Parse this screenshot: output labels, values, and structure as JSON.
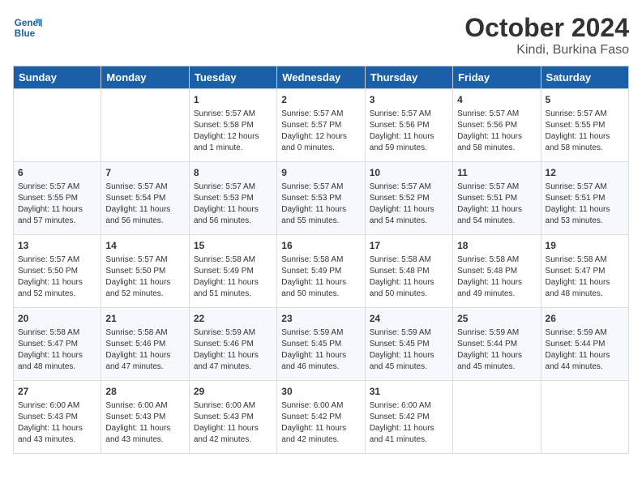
{
  "header": {
    "logo_line1": "General",
    "logo_line2": "Blue",
    "title": "October 2024",
    "subtitle": "Kindi, Burkina Faso"
  },
  "days_of_week": [
    "Sunday",
    "Monday",
    "Tuesday",
    "Wednesday",
    "Thursday",
    "Friday",
    "Saturday"
  ],
  "weeks": [
    [
      {
        "day": "",
        "detail": ""
      },
      {
        "day": "",
        "detail": ""
      },
      {
        "day": "1",
        "detail": "Sunrise: 5:57 AM\nSunset: 5:58 PM\nDaylight: 12 hours\nand 1 minute."
      },
      {
        "day": "2",
        "detail": "Sunrise: 5:57 AM\nSunset: 5:57 PM\nDaylight: 12 hours\nand 0 minutes."
      },
      {
        "day": "3",
        "detail": "Sunrise: 5:57 AM\nSunset: 5:56 PM\nDaylight: 11 hours\nand 59 minutes."
      },
      {
        "day": "4",
        "detail": "Sunrise: 5:57 AM\nSunset: 5:56 PM\nDaylight: 11 hours\nand 58 minutes."
      },
      {
        "day": "5",
        "detail": "Sunrise: 5:57 AM\nSunset: 5:55 PM\nDaylight: 11 hours\nand 58 minutes."
      }
    ],
    [
      {
        "day": "6",
        "detail": "Sunrise: 5:57 AM\nSunset: 5:55 PM\nDaylight: 11 hours\nand 57 minutes."
      },
      {
        "day": "7",
        "detail": "Sunrise: 5:57 AM\nSunset: 5:54 PM\nDaylight: 11 hours\nand 56 minutes."
      },
      {
        "day": "8",
        "detail": "Sunrise: 5:57 AM\nSunset: 5:53 PM\nDaylight: 11 hours\nand 56 minutes."
      },
      {
        "day": "9",
        "detail": "Sunrise: 5:57 AM\nSunset: 5:53 PM\nDaylight: 11 hours\nand 55 minutes."
      },
      {
        "day": "10",
        "detail": "Sunrise: 5:57 AM\nSunset: 5:52 PM\nDaylight: 11 hours\nand 54 minutes."
      },
      {
        "day": "11",
        "detail": "Sunrise: 5:57 AM\nSunset: 5:51 PM\nDaylight: 11 hours\nand 54 minutes."
      },
      {
        "day": "12",
        "detail": "Sunrise: 5:57 AM\nSunset: 5:51 PM\nDaylight: 11 hours\nand 53 minutes."
      }
    ],
    [
      {
        "day": "13",
        "detail": "Sunrise: 5:57 AM\nSunset: 5:50 PM\nDaylight: 11 hours\nand 52 minutes."
      },
      {
        "day": "14",
        "detail": "Sunrise: 5:57 AM\nSunset: 5:50 PM\nDaylight: 11 hours\nand 52 minutes."
      },
      {
        "day": "15",
        "detail": "Sunrise: 5:58 AM\nSunset: 5:49 PM\nDaylight: 11 hours\nand 51 minutes."
      },
      {
        "day": "16",
        "detail": "Sunrise: 5:58 AM\nSunset: 5:49 PM\nDaylight: 11 hours\nand 50 minutes."
      },
      {
        "day": "17",
        "detail": "Sunrise: 5:58 AM\nSunset: 5:48 PM\nDaylight: 11 hours\nand 50 minutes."
      },
      {
        "day": "18",
        "detail": "Sunrise: 5:58 AM\nSunset: 5:48 PM\nDaylight: 11 hours\nand 49 minutes."
      },
      {
        "day": "19",
        "detail": "Sunrise: 5:58 AM\nSunset: 5:47 PM\nDaylight: 11 hours\nand 48 minutes."
      }
    ],
    [
      {
        "day": "20",
        "detail": "Sunrise: 5:58 AM\nSunset: 5:47 PM\nDaylight: 11 hours\nand 48 minutes."
      },
      {
        "day": "21",
        "detail": "Sunrise: 5:58 AM\nSunset: 5:46 PM\nDaylight: 11 hours\nand 47 minutes."
      },
      {
        "day": "22",
        "detail": "Sunrise: 5:59 AM\nSunset: 5:46 PM\nDaylight: 11 hours\nand 47 minutes."
      },
      {
        "day": "23",
        "detail": "Sunrise: 5:59 AM\nSunset: 5:45 PM\nDaylight: 11 hours\nand 46 minutes."
      },
      {
        "day": "24",
        "detail": "Sunrise: 5:59 AM\nSunset: 5:45 PM\nDaylight: 11 hours\nand 45 minutes."
      },
      {
        "day": "25",
        "detail": "Sunrise: 5:59 AM\nSunset: 5:44 PM\nDaylight: 11 hours\nand 45 minutes."
      },
      {
        "day": "26",
        "detail": "Sunrise: 5:59 AM\nSunset: 5:44 PM\nDaylight: 11 hours\nand 44 minutes."
      }
    ],
    [
      {
        "day": "27",
        "detail": "Sunrise: 6:00 AM\nSunset: 5:43 PM\nDaylight: 11 hours\nand 43 minutes."
      },
      {
        "day": "28",
        "detail": "Sunrise: 6:00 AM\nSunset: 5:43 PM\nDaylight: 11 hours\nand 43 minutes."
      },
      {
        "day": "29",
        "detail": "Sunrise: 6:00 AM\nSunset: 5:43 PM\nDaylight: 11 hours\nand 42 minutes."
      },
      {
        "day": "30",
        "detail": "Sunrise: 6:00 AM\nSunset: 5:42 PM\nDaylight: 11 hours\nand 42 minutes."
      },
      {
        "day": "31",
        "detail": "Sunrise: 6:00 AM\nSunset: 5:42 PM\nDaylight: 11 hours\nand 41 minutes."
      },
      {
        "day": "",
        "detail": ""
      },
      {
        "day": "",
        "detail": ""
      }
    ]
  ]
}
